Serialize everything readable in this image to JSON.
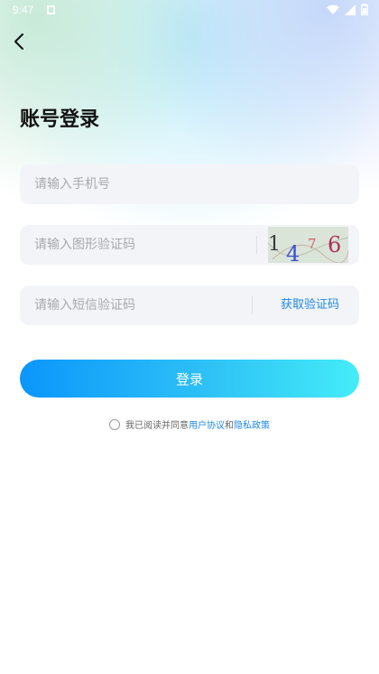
{
  "status_bar": {
    "time": "9:47"
  },
  "page": {
    "title": "账号登录"
  },
  "form": {
    "phone_placeholder": "请输入手机号",
    "captcha_placeholder": "请输入图形验证码",
    "captcha_chars": [
      "1",
      "4",
      "7",
      "6"
    ],
    "sms_placeholder": "请输入短信验证码",
    "sms_button": "获取验证码",
    "login_button": "登录"
  },
  "agreement": {
    "prefix": "我已阅读并同意",
    "user_agreement": "用户协议",
    "conjunction": "和",
    "privacy_policy": "隐私政策"
  },
  "colors": {
    "accent": "#1e88e5",
    "button_start": "#0b96fb",
    "button_end": "#44ecf8",
    "field_bg": "#f3f4f8"
  }
}
